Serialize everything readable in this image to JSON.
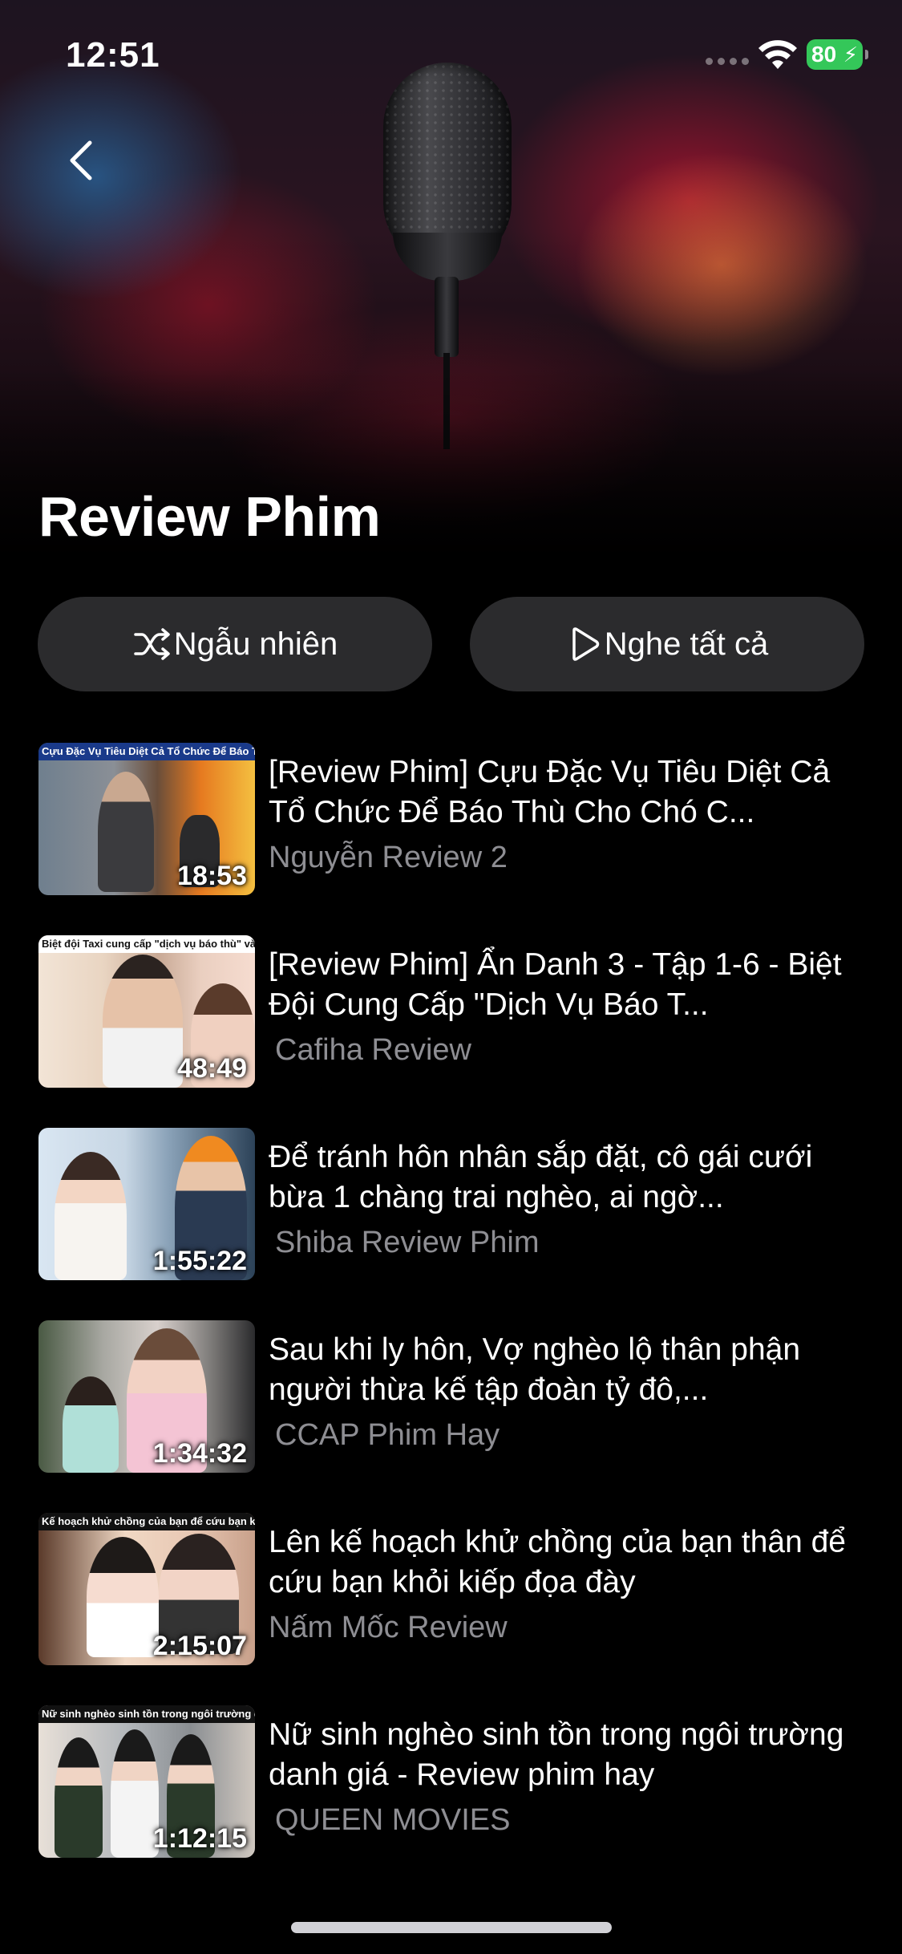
{
  "status_bar": {
    "time": "12:51",
    "battery": "80",
    "battery_color": "#34c759"
  },
  "header": {
    "back_icon": "chevron-left-icon",
    "hero_image": "microphone-bokeh"
  },
  "playlist": {
    "title": "Review Phim",
    "shuffle_label": "Ngẫu nhiên",
    "shuffle_icon": "shuffle-icon",
    "play_all_label": "Nghe tất cả",
    "play_all_icon": "play-icon"
  },
  "videos": [
    {
      "title": "[Review Phim] Cựu Đặc Vụ Tiêu Diệt Cả Tổ Chức Để Báo Thù Cho Chó C...",
      "channel": "Nguyễn Review 2",
      "duration": "18:53",
      "thumb_caption": "Cựu Đặc Vụ Tiêu Diệt Cả Tổ Chức Để Báo Thù Cho Chó"
    },
    {
      "title": "[Review Phim] Ẩn Danh 3 - Tập 1-6 - Biệt Đội Cung Cấp \"Dịch Vụ Báo T...",
      "channel": "Cafiha Review",
      "duration": "48:49",
      "thumb_caption": "Biệt đội Taxi cung cấp \"dịch vụ báo thù\" và đòi lại công lý"
    },
    {
      "title": "Để tránh hôn nhân sắp đặt, cô gái cưới bừa 1 chàng trai nghèo, ai ngờ...",
      "channel": "Shiba Review Phim",
      "duration": "1:55:22",
      "thumb_caption": ""
    },
    {
      "title": "Sau khi ly hôn, Vợ nghèo lộ thân phận người thừa kế tập đoàn tỷ đô,...",
      "channel": "CCAP Phim Hay",
      "duration": "1:34:32",
      "thumb_caption": ""
    },
    {
      "title": "Lên kế hoạch khử chồng của bạn thân để cứu bạn khỏi kiếp đọa đày",
      "channel": "Nấm Mốc Review",
      "duration": "2:15:07",
      "thumb_caption": "Kế hoạch khử chồng của bạn để cứu bạn khỏi kiếp đọa"
    },
    {
      "title": "Nữ sinh nghèo sinh tồn trong ngôi trường danh giá - Review phim hay",
      "channel": "QUEEN MOVIES",
      "duration": "1:12:15",
      "thumb_caption": "Nữ sinh nghèo sinh tồn trong ngôi trường danh"
    }
  ]
}
